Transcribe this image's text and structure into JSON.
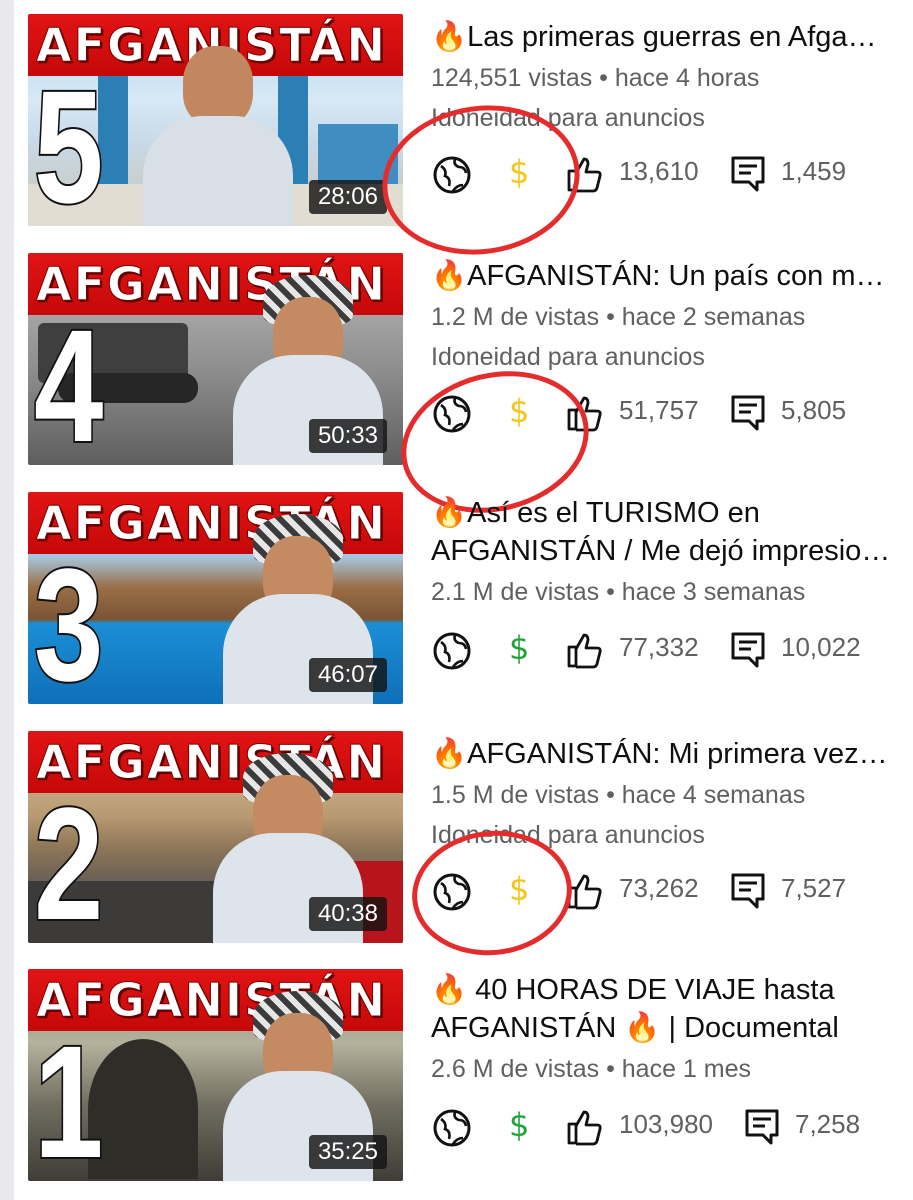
{
  "videos": [
    {
      "rank": "5",
      "banner": "AFGANISTÁN",
      "duration": "28:06",
      "title_lines": [
        "🔥Las primeras guerras en Afganistán"
      ],
      "views": "124,551 vistas • hace 4 horas",
      "monetization": "Idoneidad para anuncios",
      "dollar_color": "#f6c515",
      "likes": "13,610",
      "comments": "1,459",
      "scene": "mosque"
    },
    {
      "rank": "4",
      "banner": "AFGANISTÁN",
      "duration": "50:33",
      "title_lines": [
        "🔥AFGANISTÁN: Un país con mucha historia"
      ],
      "views": "1.2 M de vistas • hace 2 semanas",
      "monetization": "Idoneidad para anuncios",
      "dollar_color": "#f6c515",
      "likes": "51,757",
      "comments": "5,805",
      "scene": "tank"
    },
    {
      "rank": "3",
      "banner": "AFGANISTÁN",
      "duration": "46:07",
      "title_lines": [
        "🔥Así es el TURISMO en",
        "AFGANISTÁN / Me dejó impresionado"
      ],
      "views": "2.1 M de vistas • hace 3 semanas",
      "monetization": "",
      "dollar_color": "#22a33a",
      "likes": "77,332",
      "comments": "10,022",
      "scene": "lake"
    },
    {
      "rank": "2",
      "banner": "AFGANISTÁN",
      "duration": "40:38",
      "title_lines": [
        "🔥AFGANISTÁN: Mi primera vez en el país"
      ],
      "views": "1.5 M de vistas • hace 4 semanas",
      "monetization": "Idoneidad para anuncios",
      "dollar_color": "#f6c515",
      "likes": "73,262",
      "comments": "7,527",
      "scene": "road"
    },
    {
      "rank": "1",
      "banner": "AFGANISTÁN",
      "duration": "35:25",
      "title_lines": [
        "🔥 40 HORAS DE VIAJE hasta",
        "AFGANISTÁN 🔥 | Documental"
      ],
      "views": "2.6 M de vistas • hace 1 mes",
      "monetization": "",
      "dollar_color": "#22a33a",
      "likes": "103,980",
      "comments": "7,258",
      "scene": "cave"
    }
  ],
  "icons": {
    "visibility": "globe-icon",
    "monetization": "dollar-icon",
    "likes": "thumbs-up-icon",
    "comments": "comment-icon"
  },
  "colors": {
    "banner_red": "#d50c0c",
    "annotation_red": "#e52c2c",
    "meta_gray": "#606060"
  }
}
